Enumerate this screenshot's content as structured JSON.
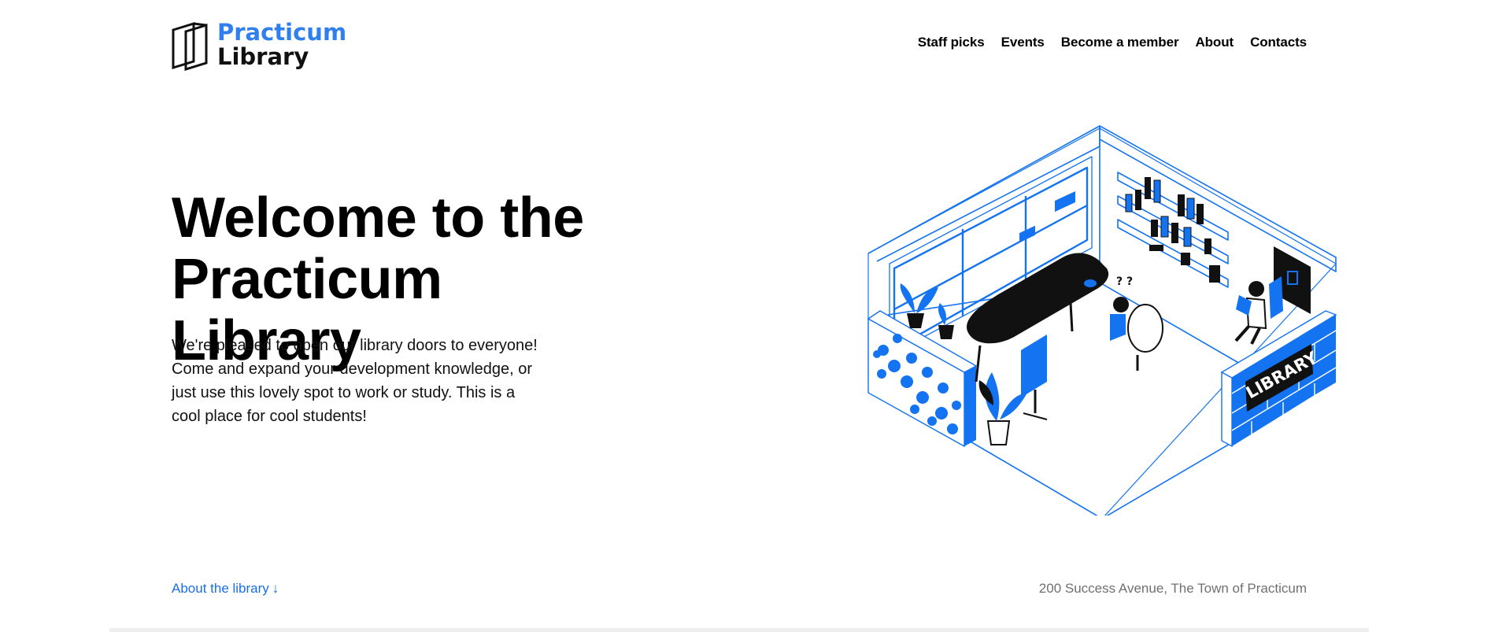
{
  "header": {
    "logo": {
      "line1": "Practicum",
      "line2": "Library"
    },
    "nav": [
      {
        "label": "Staff picks"
      },
      {
        "label": "Events"
      },
      {
        "label": "Become a member"
      },
      {
        "label": "About"
      },
      {
        "label": "Contacts"
      }
    ]
  },
  "hero": {
    "title_line1": "Welcome to the",
    "title_line2": "Practicum Library",
    "text": "We're pleased to open our library doors to everyone! Come and expand your development knowledge, or just use this lovely spot to work or study. This is a cool place for cool students!",
    "illustration": {
      "sign_text": "LIBRARY",
      "icon": "isometric-library-room-illustration"
    }
  },
  "footer": {
    "about_link": "About the library",
    "about_arrow": "↓",
    "address": "200 Success Avenue, The Town of Practicum"
  },
  "colors": {
    "brand_blue": "#2f7fee",
    "link_blue": "#1a6fe8",
    "text": "#000000",
    "muted": "#707070",
    "illustration_blue": "#1473f0"
  }
}
